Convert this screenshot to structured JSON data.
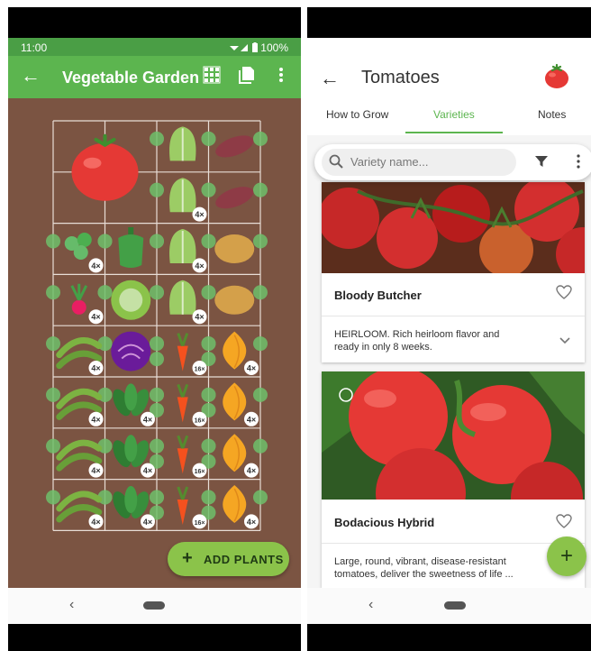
{
  "left": {
    "status": {
      "time": "11:00",
      "battery": "100%"
    },
    "appbar": {
      "title": "Vegetable Garden"
    },
    "grid": [
      [
        "tomato",
        "tomato",
        "lettuce",
        "sweet-potato"
      ],
      [
        "tomato",
        "tomato",
        "lettuce",
        "sweet-potato"
      ],
      [
        "parsley",
        "pepper",
        "lettuce",
        "potato"
      ],
      [
        "radish",
        "cabbage",
        "lettuce",
        "potato"
      ],
      [
        "peas",
        "red-cabbage",
        "carrot",
        "onion"
      ],
      [
        "peas",
        "spinach",
        "carrot",
        "onion"
      ],
      [
        "peas",
        "spinach",
        "carrot",
        "onion"
      ],
      [
        "peas",
        "spinach",
        "carrot",
        "onion"
      ]
    ],
    "badges": [
      [
        "",
        "",
        "",
        ""
      ],
      [
        "",
        "",
        "4×",
        ""
      ],
      [
        "4×",
        "",
        "4×",
        ""
      ],
      [
        "4×",
        "",
        "4×",
        ""
      ],
      [
        "4×",
        "",
        "16×",
        "4×"
      ],
      [
        "4×",
        "4×",
        "16×",
        "4×"
      ],
      [
        "4×",
        "4×",
        "16×",
        "4×"
      ],
      [
        "4×",
        "4×",
        "16×",
        "4×"
      ]
    ],
    "fab_label": "ADD PLANTS"
  },
  "right": {
    "title": "Tomatoes",
    "tabs": [
      "How to Grow",
      "Varieties",
      "Notes"
    ],
    "active_tab": "Varieties",
    "search_placeholder": "Variety name...",
    "cards": [
      {
        "name": "Bloody Butcher",
        "description": "HEIRLOOM. Rich heirloom flavor and ready in only 8 weeks."
      },
      {
        "name": "Bodacious Hybrid",
        "description": "Large, round, vibrant, disease-resistant tomatoes, deliver the sweetness of life ..."
      }
    ]
  },
  "colors": {
    "primary": "#5cb54f",
    "primary_dark": "#4a9e45",
    "accent": "#8bc34a",
    "soil": "#7b5442"
  }
}
